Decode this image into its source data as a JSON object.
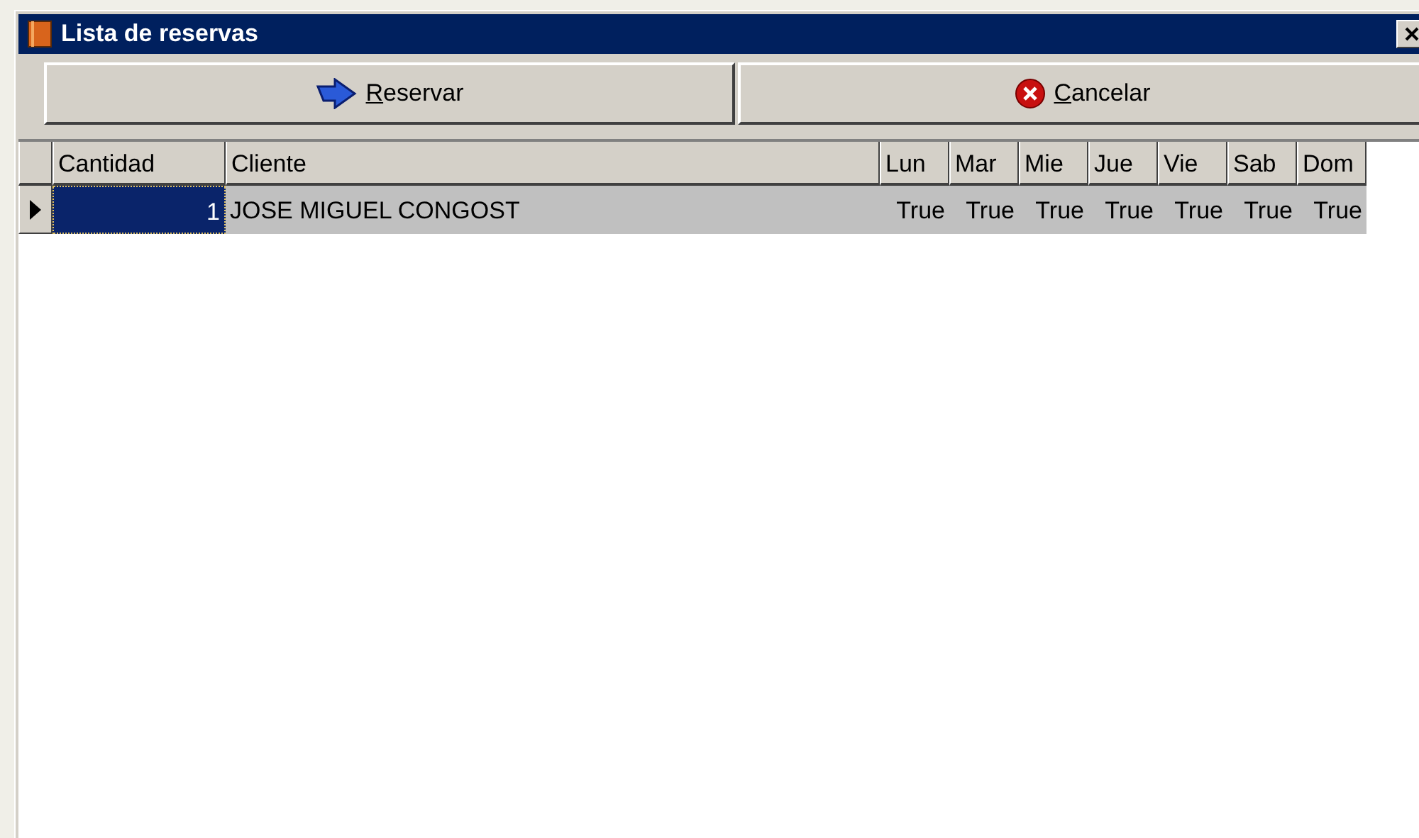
{
  "window": {
    "title": "Lista de reservas"
  },
  "buttons": [
    {
      "kind": "reserve",
      "label": "Reservar"
    },
    {
      "kind": "cancel",
      "label": "Cancelar"
    }
  ],
  "table": {
    "columns": [
      "Cantidad",
      "Cliente",
      "Lun",
      "Mar",
      "Mie",
      "Jue",
      "Vie",
      "Sab",
      "Dom"
    ],
    "rows": [
      {
        "selected": true,
        "cells": [
          "1",
          "JOSE MIGUEL CONGOST",
          "True",
          "True",
          "True",
          "True",
          "True",
          "True",
          "True"
        ]
      }
    ]
  }
}
